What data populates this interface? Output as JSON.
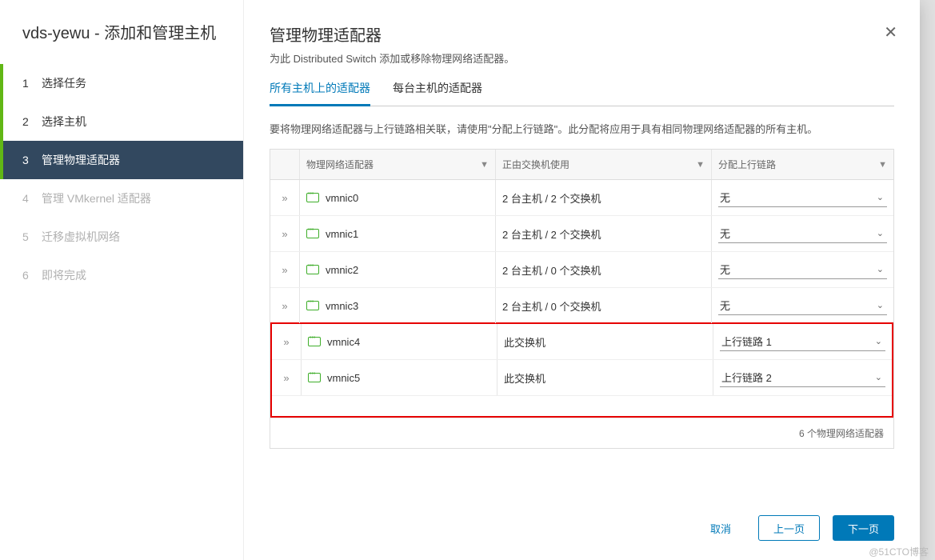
{
  "sidebar": {
    "title": "vds-yewu - 添加和管理主机",
    "steps": [
      {
        "num": "1",
        "label": "选择任务",
        "state": "done"
      },
      {
        "num": "2",
        "label": "选择主机",
        "state": "done"
      },
      {
        "num": "3",
        "label": "管理物理适配器",
        "state": "active"
      },
      {
        "num": "4",
        "label": "管理 VMkernel 适配器",
        "state": "disabled"
      },
      {
        "num": "5",
        "label": "迁移虚拟机网络",
        "state": "disabled"
      },
      {
        "num": "6",
        "label": "即将完成",
        "state": "disabled"
      }
    ]
  },
  "main": {
    "title": "管理物理适配器",
    "subtitle": "为此 Distributed Switch 添加或移除物理网络适配器。",
    "tabs": [
      {
        "label": "所有主机上的适配器",
        "active": true
      },
      {
        "label": "每台主机的适配器",
        "active": false
      }
    ],
    "description": "要将物理网络适配器与上行链路相关联，请使用\"分配上行链路\"。此分配将应用于具有相同物理网络适配器的所有主机。",
    "columns": {
      "adapter": "物理网络适配器",
      "usedBy": "正由交换机使用",
      "uplink": "分配上行链路"
    },
    "rows": [
      {
        "name": "vmnic0",
        "usedBy": "2 台主机 / 2 个交换机",
        "uplink": "无",
        "hl": false
      },
      {
        "name": "vmnic1",
        "usedBy": "2 台主机 / 2 个交换机",
        "uplink": "无",
        "hl": false
      },
      {
        "name": "vmnic2",
        "usedBy": "2 台主机 / 0 个交换机",
        "uplink": "无",
        "hl": false
      },
      {
        "name": "vmnic3",
        "usedBy": "2 台主机 / 0 个交换机",
        "uplink": "无",
        "hl": false
      },
      {
        "name": "vmnic4",
        "usedBy": "此交换机",
        "uplink": "上行链路 1",
        "hl": true
      },
      {
        "name": "vmnic5",
        "usedBy": "此交换机",
        "uplink": "上行链路 2",
        "hl": true
      }
    ],
    "footer": "6 个物理网络适配器",
    "buttons": {
      "cancel": "取消",
      "back": "上一页",
      "next": "下一页"
    }
  },
  "watermark": "@51CTO博客"
}
